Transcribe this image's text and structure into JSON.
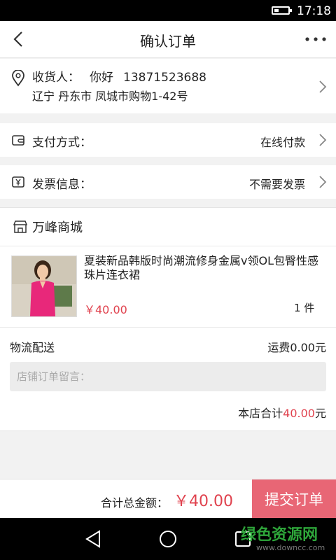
{
  "statusbar": {
    "time": "17:18",
    "battery_level": 0.2
  },
  "nav": {
    "title": "确认订单"
  },
  "address": {
    "label": "收货人：",
    "name": "你好",
    "phone": "13871523688",
    "address": "辽宁 丹东市 凤城市购物1-42号"
  },
  "payment": {
    "label": "支付方式：",
    "value": "在线付款"
  },
  "invoice": {
    "label": "发票信息：",
    "value": "不需要发票"
  },
  "shop": {
    "name": "万峰商城",
    "product": {
      "title": "夏装新品韩版时尚潮流修身金属v领OL包臀性感珠片连衣裙",
      "price": "￥40.00",
      "quantity": "1 件"
    },
    "shipping_label": "物流配送",
    "shipping_fee": "运费0.00元",
    "note_placeholder": "店铺订单留言：",
    "subtotal_label": "本店合计",
    "subtotal_amount": "40.00",
    "subtotal_unit": "元"
  },
  "footer": {
    "total_label": "合计总金额：",
    "total_amount": "￥40.00",
    "submit_label": "提交订单"
  },
  "watermark": {
    "name": "绿色资源网",
    "url": "www.downcc.com"
  },
  "colors": {
    "accent": "#e0424e",
    "submit_bg": "#e86675",
    "watermark_green": "#2ea63a"
  }
}
